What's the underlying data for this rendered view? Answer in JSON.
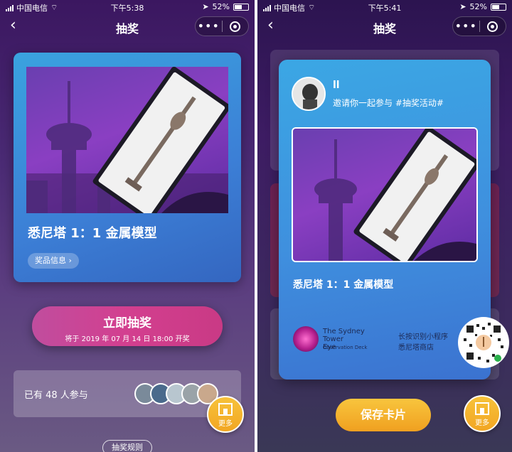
{
  "left_screen": {
    "status": {
      "carrier": "中国电信",
      "time": "下午5:38",
      "battery": "52%"
    },
    "nav": {
      "back_icon": "chevron-left-icon",
      "title": "抽奖",
      "more_icon": "ellipsis-icon",
      "close_icon": "target-icon"
    },
    "prize": {
      "title": "悉尼塔 1：1 金属模型",
      "info_label": "奖品信息 ›"
    },
    "draw_button": {
      "label": "立即抽奖",
      "sub": "将于 2019 年 07 月 14 日 18:00 开奖"
    },
    "participants": {
      "text": "已有 48 人参与"
    },
    "rules_label": "抽奖规则",
    "more_fab": {
      "label": "更多",
      "icon": "store-icon"
    }
  },
  "right_screen": {
    "status": {
      "carrier": "中国电信",
      "time": "下午5:41",
      "battery": "52%"
    },
    "nav": {
      "back_icon": "chevron-left-icon",
      "title": "抽奖",
      "more_icon": "ellipsis-icon",
      "close_icon": "target-icon"
    },
    "share_card": {
      "user_name": "ll",
      "invite_text": "邀请你一起参与 #抽奖活动#",
      "prize_title": "悉尼塔 1：1 金属模型",
      "logo_line1": "The Sydney Tower",
      "logo_line2": "Eye",
      "logo_small": "Observation Deck",
      "hint_line1": "长按识别小程序",
      "hint_line2": "悉尼塔商店"
    },
    "save_button": "保存卡片",
    "more_fab": {
      "label": "更多",
      "icon": "store-icon"
    }
  },
  "colors": {
    "card_blue": "#3b8fde",
    "pink_button": "#d33f8f",
    "gold_button": "#f2a623"
  }
}
